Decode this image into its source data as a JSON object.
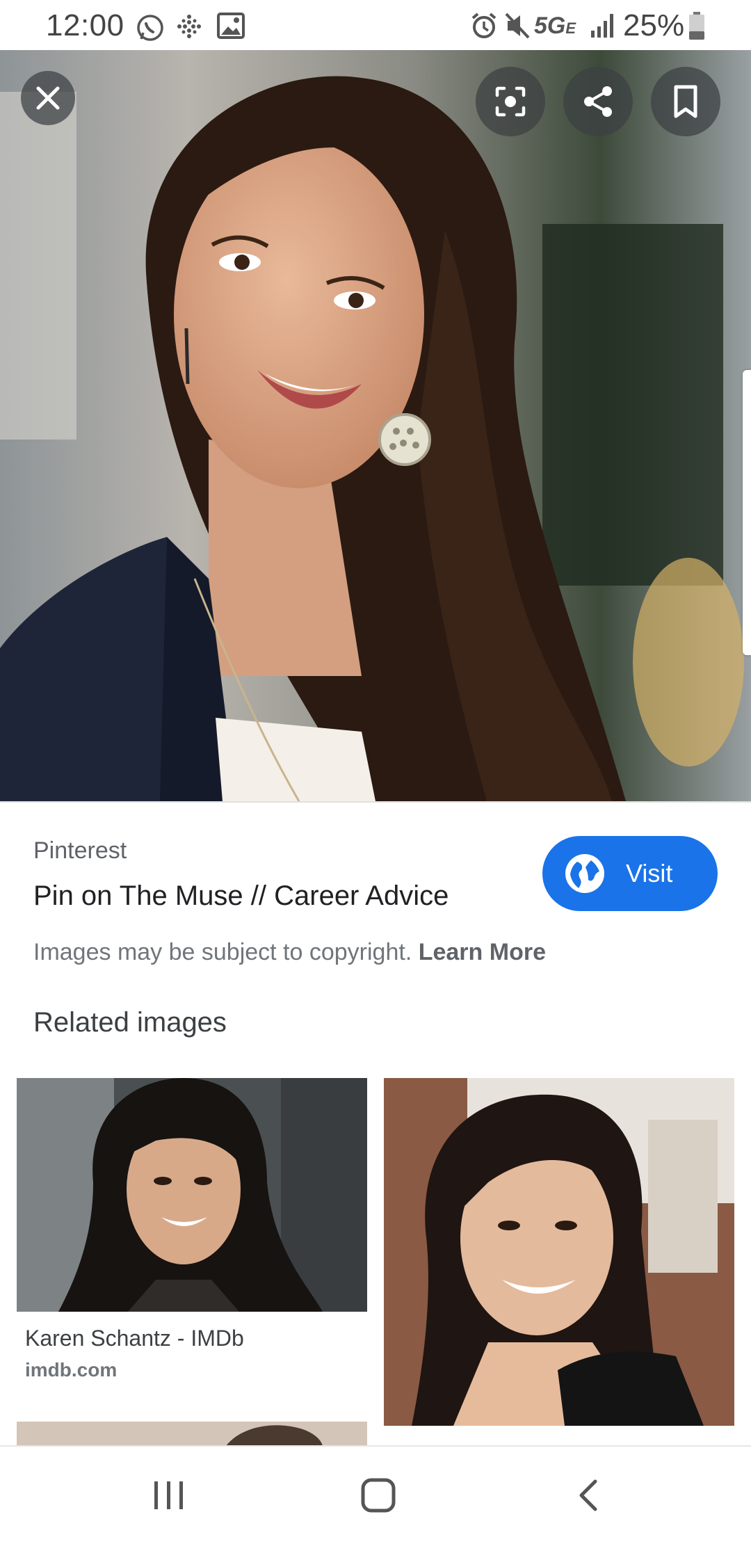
{
  "status_bar": {
    "time": "12:00",
    "network": "5G",
    "network_suffix": "E",
    "battery": "25%",
    "icons": [
      "whatsapp-icon",
      "grid-dots-icon",
      "gallery-icon",
      "alarm-icon",
      "mute-icon",
      "signal-icon",
      "battery-icon"
    ]
  },
  "viewer": {
    "close_icon": "close-icon",
    "lens_icon": "lens-icon",
    "share_icon": "share-icon",
    "save_icon": "bookmark-icon"
  },
  "result": {
    "source": "Pinterest",
    "title": "Pin on The Muse // Career Advice",
    "visit_label": "Visit",
    "copyright_text": "Images may be subject to copyright.",
    "learn_more": "Learn More"
  },
  "related": {
    "heading": "Related images",
    "items": [
      {
        "caption": "Karen Schantz - IMDb",
        "domain": "imdb.com"
      }
    ]
  },
  "colors": {
    "accent": "#1a73e8",
    "overlay_button": "#3c4043"
  },
  "nav": {
    "icons": [
      "recents-icon",
      "home-icon",
      "back-icon"
    ]
  }
}
